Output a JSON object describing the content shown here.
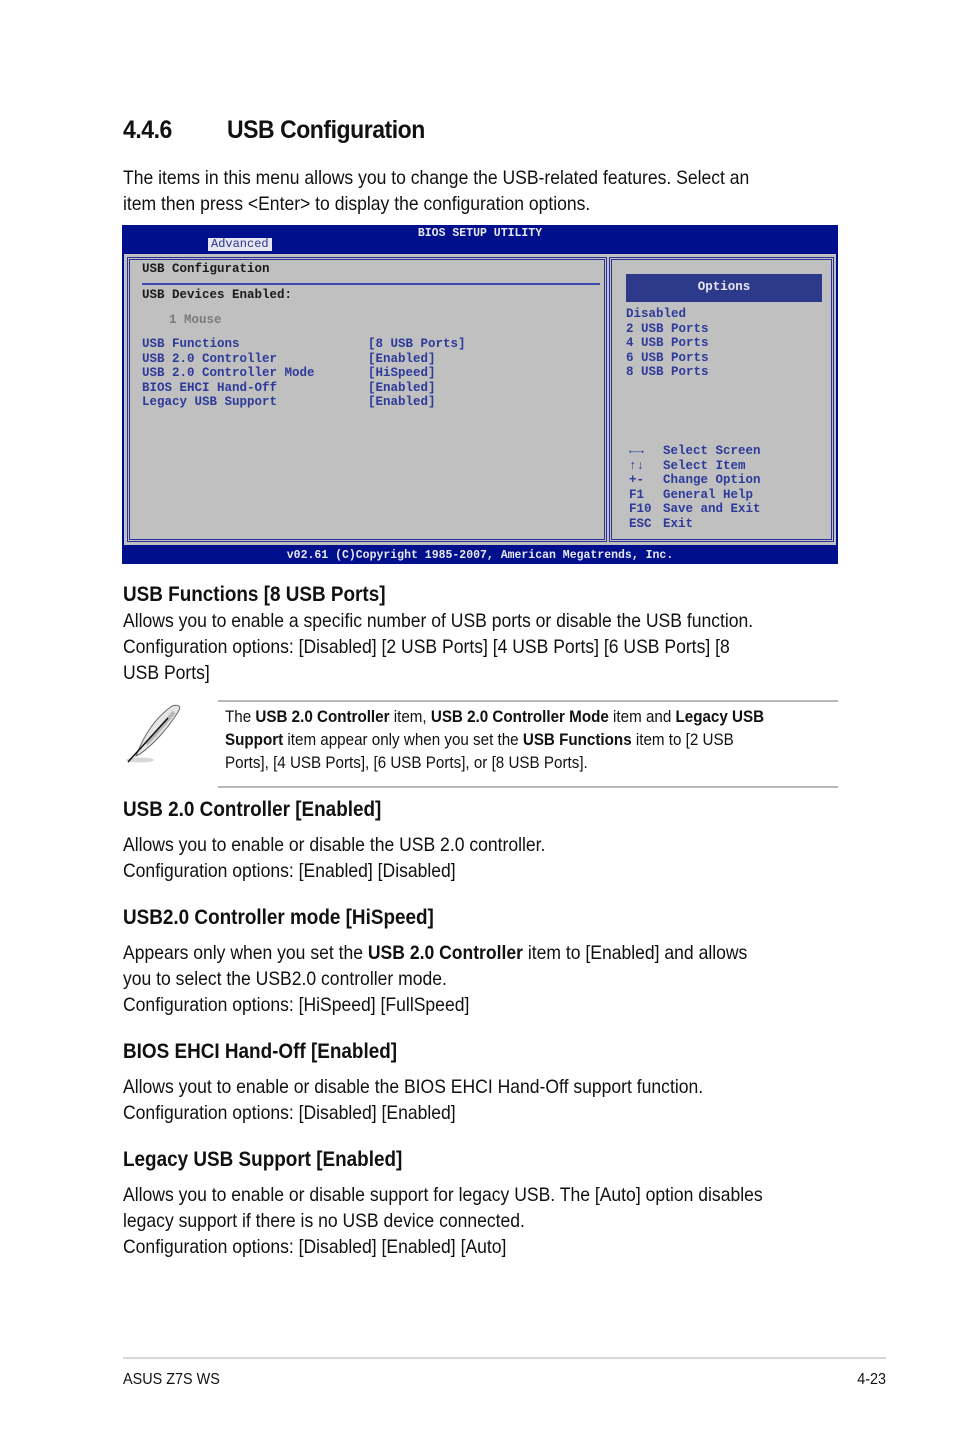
{
  "section": {
    "number": "4.4.6",
    "title": "USB Configuration",
    "intro_lines": [
      "The items in this menu allows you to change the USB-related features. Select an",
      "item then press <Enter> to display the configuration options."
    ]
  },
  "bios": {
    "title": "BIOS SETUP UTILITY",
    "active_tab": "Advanced",
    "panel_title": "USB Configuration",
    "devices_label": "USB Devices Enabled:",
    "devices": "1 Mouse",
    "items": [
      {
        "label": "USB Functions",
        "value": "[8 USB Ports]"
      },
      {
        "label": "USB 2.0 Controller",
        "value": "[Enabled]"
      },
      {
        "label": "USB 2.0 Controller Mode",
        "value": "[HiSpeed]"
      },
      {
        "label": "BIOS EHCI Hand-Off",
        "value": "[Enabled]"
      },
      {
        "label": "Legacy USB Support",
        "value": "[Enabled]"
      }
    ],
    "options_header": "Options",
    "options": [
      "Disabled",
      "2 USB Ports",
      "4 USB Ports",
      "6 USB Ports",
      "8 USB Ports"
    ],
    "keys": [
      {
        "key": "←→",
        "icon": "left-right-arrows-icon",
        "action": "Select Screen"
      },
      {
        "key": "↑↓",
        "icon": "up-down-arrows-icon",
        "action": "Select Item"
      },
      {
        "key": "+-",
        "action": "Change Option"
      },
      {
        "key": "F1",
        "action": "General Help"
      },
      {
        "key": "F10",
        "action": "Save and Exit"
      },
      {
        "key": "ESC",
        "action": "Exit"
      }
    ],
    "footer": "v02.61 (C)Copyright 1985-2007, American Megatrends, Inc.",
    "colors": {
      "frame": "#000f8c",
      "panel": "#c0c0c0",
      "text_blue": "#2d3a9a",
      "options_bg": "#2d3a8c"
    }
  },
  "usb_functions": {
    "heading": "USB Functions [8 USB Ports]",
    "lines": [
      "Allows you to enable a specific number of USB ports or disable the USB function.",
      "Configuration options: [Disabled] [2 USB Ports] [4 USB Ports] [6 USB Ports] [8",
      "USB Ports]"
    ]
  },
  "note": {
    "icon": "feather-pen-icon",
    "parts": {
      "p1": "The ",
      "b1": "USB 2.0 Controller",
      "p2": " item, ",
      "b2": "USB 2.0 Controller Mode",
      "p3": " item and ",
      "b3": "Legacy USB",
      "b4": "Support",
      "p4": " item appear only when you set the ",
      "b5": "USB Functions",
      "p5": " item to [2 USB",
      "line3": "Ports], [4 USB Ports], [6 USB Ports], or [8 USB Ports]."
    }
  },
  "usb20_controller": {
    "heading": "USB 2.0 Controller [Enabled]",
    "lines": [
      "Allows you to enable or disable the USB 2.0 controller.",
      "Configuration options: [Enabled] [Disabled]"
    ]
  },
  "usb20_mode": {
    "heading": "USB2.0 Controller mode [HiSpeed]",
    "l1a": "Appears only when you set the ",
    "l1b": "USB 2.0 Controller",
    "l1c": " item to [Enabled] and allows",
    "lines": [
      "you to select the USB2.0 controller mode.",
      "Configuration options: [HiSpeed] [FullSpeed]"
    ]
  },
  "ehci": {
    "heading": "BIOS EHCI Hand-Off [Enabled]",
    "lines": [
      "Allows yout to enable or disable the BIOS EHCI Hand-Off support function.",
      "Configuration options: [Disabled] [Enabled]"
    ]
  },
  "legacy": {
    "heading": "Legacy USB Support [Enabled]",
    "lines": [
      "Allows you to enable or disable support for legacy USB. The [Auto] option disables",
      "legacy support if there is no USB device connected.",
      "Configuration options: [Disabled] [Enabled] [Auto]"
    ]
  },
  "footer": {
    "product": "ASUS Z7S WS",
    "page": "4-23"
  }
}
